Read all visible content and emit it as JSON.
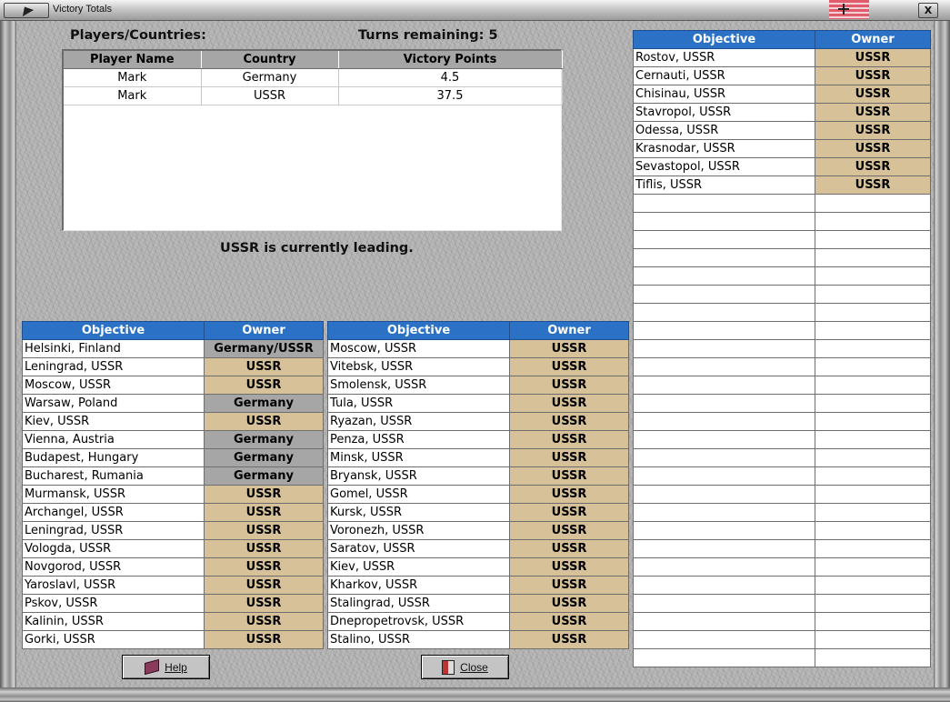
{
  "window": {
    "title": "Victory Totals",
    "close_glyph": "X"
  },
  "header": {
    "players_title": "Players/Countries:",
    "turns_label": "Turns remaining: 5"
  },
  "players": {
    "columns": [
      "Player Name",
      "Country",
      "Victory Points"
    ],
    "rows": [
      [
        "Mark",
        "Germany",
        "4.5"
      ],
      [
        "Mark",
        "USSR",
        "37.5"
      ]
    ]
  },
  "status": {
    "leading": "USSR is currently leading."
  },
  "objective_table": {
    "header_objective": "Objective",
    "header_owner": "Owner"
  },
  "objectives_left": [
    {
      "name": "Helsinki, Finland",
      "owner": "Germany/USSR"
    },
    {
      "name": "Leningrad, USSR",
      "owner": "USSR"
    },
    {
      "name": "Moscow, USSR",
      "owner": "USSR"
    },
    {
      "name": "Warsaw, Poland",
      "owner": "Germany"
    },
    {
      "name": "Kiev, USSR",
      "owner": "USSR"
    },
    {
      "name": "Vienna, Austria",
      "owner": "Germany"
    },
    {
      "name": "Budapest, Hungary",
      "owner": "Germany"
    },
    {
      "name": "Bucharest, Rumania",
      "owner": "Germany"
    },
    {
      "name": "Murmansk, USSR",
      "owner": "USSR"
    },
    {
      "name": "Archangel, USSR",
      "owner": "USSR"
    },
    {
      "name": "Leningrad, USSR",
      "owner": "USSR"
    },
    {
      "name": "Vologda, USSR",
      "owner": "USSR"
    },
    {
      "name": "Novgorod, USSR",
      "owner": "USSR"
    },
    {
      "name": "Yaroslavl, USSR",
      "owner": "USSR"
    },
    {
      "name": "Pskov, USSR",
      "owner": "USSR"
    },
    {
      "name": "Kalinin, USSR",
      "owner": "USSR"
    },
    {
      "name": "Gorki, USSR",
      "owner": "USSR"
    }
  ],
  "objectives_middle": [
    {
      "name": "Moscow, USSR",
      "owner": "USSR"
    },
    {
      "name": "Vitebsk, USSR",
      "owner": "USSR"
    },
    {
      "name": "Smolensk, USSR",
      "owner": "USSR"
    },
    {
      "name": "Tula, USSR",
      "owner": "USSR"
    },
    {
      "name": "Ryazan, USSR",
      "owner": "USSR"
    },
    {
      "name": "Penza, USSR",
      "owner": "USSR"
    },
    {
      "name": "Minsk, USSR",
      "owner": "USSR"
    },
    {
      "name": "Bryansk, USSR",
      "owner": "USSR"
    },
    {
      "name": "Gomel, USSR",
      "owner": "USSR"
    },
    {
      "name": "Kursk, USSR",
      "owner": "USSR"
    },
    {
      "name": "Voronezh, USSR",
      "owner": "USSR"
    },
    {
      "name": "Saratov, USSR",
      "owner": "USSR"
    },
    {
      "name": "Kiev, USSR",
      "owner": "USSR"
    },
    {
      "name": "Kharkov, USSR",
      "owner": "USSR"
    },
    {
      "name": "Stalingrad, USSR",
      "owner": "USSR"
    },
    {
      "name": "Dnepropetrovsk, USSR",
      "owner": "USSR"
    },
    {
      "name": "Stalino, USSR",
      "owner": "USSR"
    }
  ],
  "objectives_right": [
    {
      "name": "Rostov, USSR",
      "owner": "USSR"
    },
    {
      "name": "Cernauti, USSR",
      "owner": "USSR"
    },
    {
      "name": "Chisinau, USSR",
      "owner": "USSR"
    },
    {
      "name": "Stavropol, USSR",
      "owner": "USSR"
    },
    {
      "name": "Odessa, USSR",
      "owner": "USSR"
    },
    {
      "name": "Krasnodar, USSR",
      "owner": "USSR"
    },
    {
      "name": "Sevastopol, USSR",
      "owner": "USSR"
    },
    {
      "name": "Tiflis, USSR",
      "owner": "USSR"
    }
  ],
  "buttons": {
    "help_label": "Help",
    "close_label": "Close"
  },
  "icons": {
    "help": "book-icon",
    "close": "exit-door-icon",
    "flag": "war-ensign-icon"
  },
  "colors": {
    "header_blue": "#2b72c7",
    "ussr_owner": "#d6c198",
    "germany_owner": "#a6a6a6"
  }
}
